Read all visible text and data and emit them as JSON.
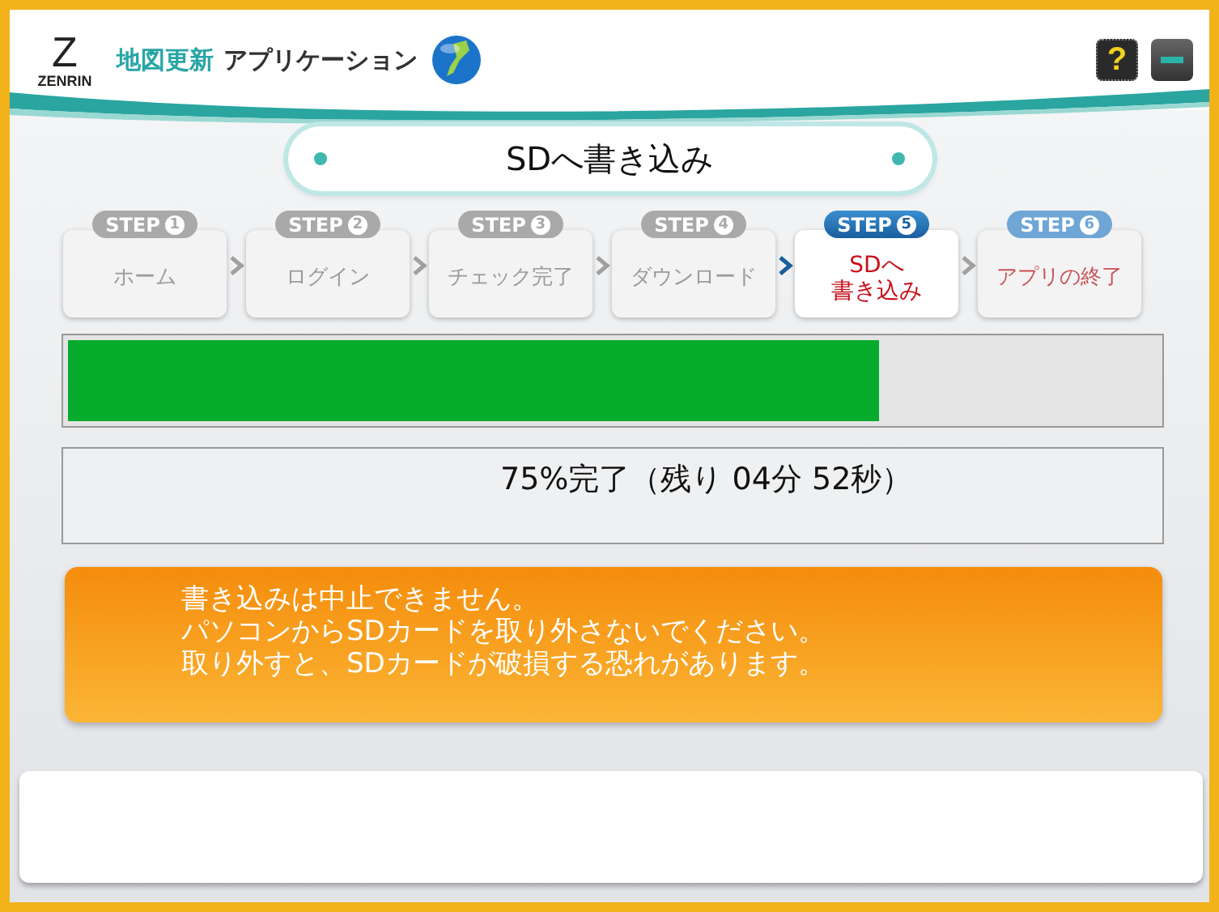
{
  "header": {
    "logo_mark": "Z",
    "logo_text": "ZENRIN",
    "title_accent": "地図更新",
    "title": "アプリケーション",
    "help_label": "?"
  },
  "page_title": "SDへ書き込み",
  "steps": [
    {
      "badge": "STEP",
      "number": "1",
      "lines": [
        "ホーム"
      ],
      "kind": "done",
      "selected": false
    },
    {
      "badge": "STEP",
      "number": "2",
      "lines": [
        "ログイン"
      ],
      "kind": "done",
      "selected": false
    },
    {
      "badge": "STEP",
      "number": "3",
      "lines": [
        "チェック完了"
      ],
      "kind": "done",
      "selected": false
    },
    {
      "badge": "STEP",
      "number": "4",
      "lines": [
        "ダウンロード"
      ],
      "kind": "done",
      "selected": false
    },
    {
      "badge": "STEP",
      "number": "5",
      "lines": [
        "SDへ",
        "書き込み"
      ],
      "kind": "current",
      "selected": true
    },
    {
      "badge": "STEP",
      "number": "6",
      "lines": [
        "アプリの終了"
      ],
      "kind": "todo",
      "selected": false
    }
  ],
  "progress": {
    "level": 0.745,
    "reading": "75%完了（残り 04分 52秒）"
  },
  "warning": [
    "書き込みは中止できません。",
    "パソコンからSDカードを取り外さないでください。",
    "取り外すと、SDカードが破損する恐れがあります。"
  ]
}
